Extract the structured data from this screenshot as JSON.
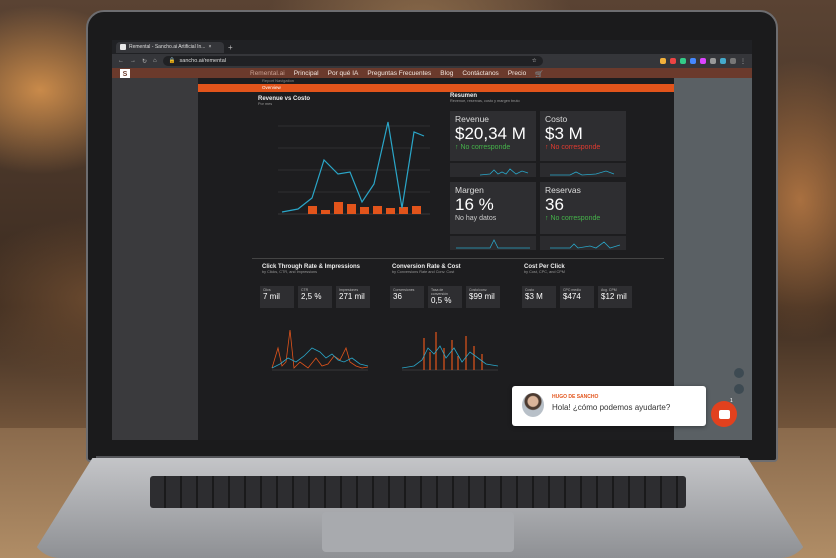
{
  "browser": {
    "tab_title": "Remental - Sancho.ai Artificial In...",
    "new_tab": "+",
    "url": "sancho.ai/remental"
  },
  "site_nav": {
    "logo": "S",
    "links": [
      "Remental.ai",
      "Principal",
      "Por qué IA",
      "Preguntas Frecuentes",
      "Blog",
      "Contáctanos",
      "Precio"
    ]
  },
  "report": {
    "header_small": "Report Navigation",
    "header_bar": "Overview",
    "revenue_chart": {
      "title": "Revenue vs Costo",
      "subtitle": "Por mes"
    },
    "resumen": {
      "title": "Resumen",
      "subtitle": "Revenue, reservas, costo y margen bruto"
    },
    "kpis": [
      {
        "label": "Revenue",
        "value": "$20,34 M",
        "change": "↑ No corresponde",
        "color": "#45b34a"
      },
      {
        "label": "Costo",
        "value": "$3 M",
        "change": "↑ No corresponde",
        "color": "#e03b30"
      },
      {
        "label": "Margen",
        "value": "16 %",
        "change": "No hay datos",
        "color": "#cccccc"
      },
      {
        "label": "Reservas",
        "value": "36",
        "change": "↑ No corresponde",
        "color": "#45b34a"
      }
    ],
    "sections": [
      {
        "title": "Click Through Rate & Impressions",
        "subtitle": "by Clicks, CTR, and Impressions",
        "minis": [
          {
            "label": "Clics",
            "value": "7 mil"
          },
          {
            "label": "CTR",
            "value": "2,5 %"
          },
          {
            "label": "Impresiones",
            "value": "271 mil"
          }
        ]
      },
      {
        "title": "Conversion Rate & Cost",
        "subtitle": "by Conversions Rate and Conv. Cost",
        "minis": [
          {
            "label": "Conversiones",
            "value": "36"
          },
          {
            "label": "Tasa de conversión",
            "value": "0,5 %"
          },
          {
            "label": "Costo/conv.",
            "value": "$99 mil"
          }
        ]
      },
      {
        "title": "Cost Per Click",
        "subtitle": "by Cost, CPC, and CPM",
        "minis": [
          {
            "label": "Costo",
            "value": "$3 M"
          },
          {
            "label": "CPC medio",
            "value": "$474"
          },
          {
            "label": "Avg. CPM",
            "value": "$12 mil"
          }
        ]
      }
    ]
  },
  "chat": {
    "name": "HUGO DE SANCHO",
    "message": "Hola! ¿cómo podemos ayudarte?",
    "badge": "1"
  },
  "colors": {
    "accent": "#e2541b",
    "line": "#2aa6c8",
    "nav_bg": "#6b3a2c"
  }
}
